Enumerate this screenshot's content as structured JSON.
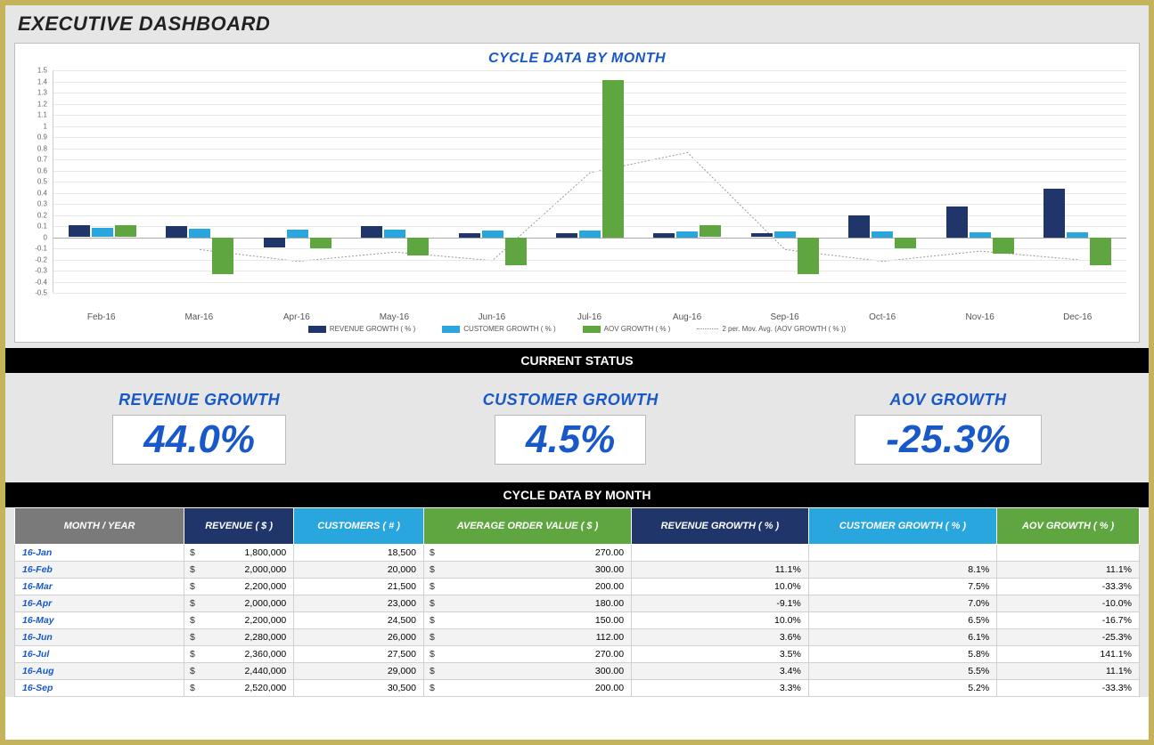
{
  "title": "EXECUTIVE DASHBOARD",
  "chart": {
    "title": "CYCLE DATA BY MONTH",
    "yMin": -0.5,
    "yMax": 1.5,
    "yTicks": [
      -0.5,
      -0.4,
      -0.3,
      -0.2,
      -0.1,
      0,
      0.1,
      0.2,
      0.3,
      0.4,
      0.5,
      0.6,
      0.7,
      0.8,
      0.9,
      1,
      1.1,
      1.2,
      1.3,
      1.4,
      1.5
    ],
    "legend": {
      "revenue": "REVENUE GROWTH  ( % )",
      "customer": "CUSTOMER GROWTH  ( % )",
      "aov": "AOV GROWTH  ( % )",
      "mov": "2 per. Mov. Avg.  (AOV GROWTH  ( % ))"
    }
  },
  "section_current": "CURRENT STATUS",
  "status": {
    "revenue": {
      "label": "REVENUE GROWTH",
      "value": "44.0%"
    },
    "customer": {
      "label": "CUSTOMER GROWTH",
      "value": "4.5%"
    },
    "aov": {
      "label": "AOV GROWTH",
      "value": "-25.3%"
    }
  },
  "section_table": "CYCLE DATA BY MONTH",
  "table": {
    "headers": {
      "month": "MONTH / YEAR",
      "revenue": "REVENUE  ( $ )",
      "customers": "CUSTOMERS  ( # )",
      "aov": "AVERAGE ORDER VALUE  ( $ )",
      "rev_growth": "REVENUE GROWTH  ( % )",
      "cust_growth": "CUSTOMER GROWTH  ( % )",
      "aov_growth": "AOV GROWTH  ( % )"
    },
    "currency": "$",
    "rows": [
      {
        "month": "16-Jan",
        "revenue": "1,800,000",
        "customers": "18,500",
        "aov": "270.00",
        "rev_growth": "",
        "cust_growth": "",
        "aov_growth": ""
      },
      {
        "month": "16-Feb",
        "revenue": "2,000,000",
        "customers": "20,000",
        "aov": "300.00",
        "rev_growth": "11.1%",
        "cust_growth": "8.1%",
        "aov_growth": "11.1%"
      },
      {
        "month": "16-Mar",
        "revenue": "2,200,000",
        "customers": "21,500",
        "aov": "200.00",
        "rev_growth": "10.0%",
        "cust_growth": "7.5%",
        "aov_growth": "-33.3%"
      },
      {
        "month": "16-Apr",
        "revenue": "2,000,000",
        "customers": "23,000",
        "aov": "180.00",
        "rev_growth": "-9.1%",
        "cust_growth": "7.0%",
        "aov_growth": "-10.0%"
      },
      {
        "month": "16-May",
        "revenue": "2,200,000",
        "customers": "24,500",
        "aov": "150.00",
        "rev_growth": "10.0%",
        "cust_growth": "6.5%",
        "aov_growth": "-16.7%"
      },
      {
        "month": "16-Jun",
        "revenue": "2,280,000",
        "customers": "26,000",
        "aov": "112.00",
        "rev_growth": "3.6%",
        "cust_growth": "6.1%",
        "aov_growth": "-25.3%"
      },
      {
        "month": "16-Jul",
        "revenue": "2,360,000",
        "customers": "27,500",
        "aov": "270.00",
        "rev_growth": "3.5%",
        "cust_growth": "5.8%",
        "aov_growth": "141.1%"
      },
      {
        "month": "16-Aug",
        "revenue": "2,440,000",
        "customers": "29,000",
        "aov": "300.00",
        "rev_growth": "3.4%",
        "cust_growth": "5.5%",
        "aov_growth": "11.1%"
      },
      {
        "month": "16-Sep",
        "revenue": "2,520,000",
        "customers": "30,500",
        "aov": "200.00",
        "rev_growth": "3.3%",
        "cust_growth": "5.2%",
        "aov_growth": "-33.3%"
      }
    ]
  },
  "chart_data": {
    "type": "bar",
    "title": "CYCLE DATA BY MONTH",
    "xlabel": "",
    "ylabel": "",
    "ylim": [
      -0.5,
      1.5
    ],
    "categories": [
      "Feb-16",
      "Mar-16",
      "Apr-16",
      "May-16",
      "Jun-16",
      "Jul-16",
      "Aug-16",
      "Sep-16",
      "Oct-16",
      "Nov-16",
      "Dec-16"
    ],
    "series": [
      {
        "name": "REVENUE GROWTH  ( % )",
        "values": [
          0.111,
          0.1,
          -0.091,
          0.1,
          0.036,
          0.035,
          0.034,
          0.033,
          0.2,
          0.28,
          0.44
        ]
      },
      {
        "name": "CUSTOMER GROWTH  ( % )",
        "values": [
          0.081,
          0.075,
          0.07,
          0.065,
          0.061,
          0.058,
          0.055,
          0.052,
          0.05,
          0.048,
          0.045
        ]
      },
      {
        "name": "AOV GROWTH  ( % )",
        "values": [
          0.111,
          -0.333,
          -0.1,
          -0.167,
          -0.253,
          1.411,
          0.111,
          -0.333,
          -0.1,
          -0.15,
          -0.253
        ]
      }
    ],
    "moving_avg": {
      "name": "2 per. Mov. Avg.  (AOV GROWTH  ( % ))",
      "values": [
        null,
        -0.111,
        -0.217,
        -0.134,
        -0.21,
        0.579,
        0.761,
        -0.111,
        -0.217,
        -0.125,
        -0.202
      ]
    }
  }
}
